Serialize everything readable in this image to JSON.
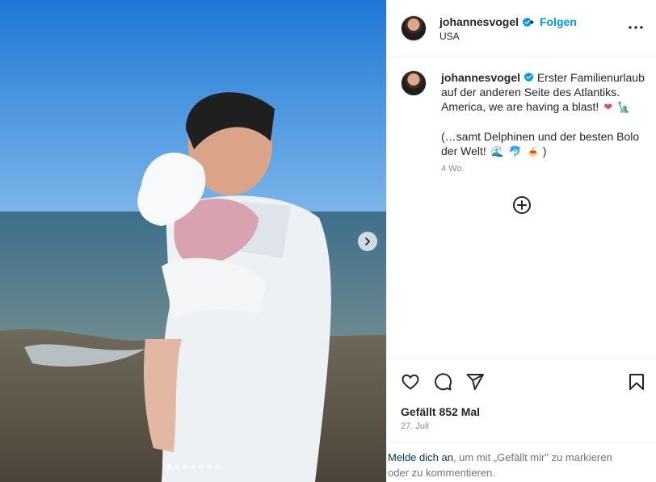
{
  "post": {
    "username": "johannesvogel",
    "follow_label": "Folgen",
    "separator": "•",
    "location": "USA",
    "caption_lines": [
      "Erster Familienurlaub",
      "auf der anderen Seite des Atlantiks.",
      "America, we are having a blast!",
      "(…samt Delphinen und der besten Bolo",
      "der Welt!"
    ],
    "caption_close": ")",
    "emojis": {
      "heart": "❤",
      "liberty": "🗽",
      "wave": "🌊",
      "dolphin": "🐬",
      "bolo": "🍝"
    },
    "time_ago": "4 Wo.",
    "likes": "Gefällt 852 Mal",
    "date": "27. Juli",
    "carousel": {
      "total": 7,
      "current": 1
    }
  },
  "login_prompt": {
    "link": "Melde dich an",
    "text_1": ", um mit „Gefällt mir\" zu markieren",
    "text_2": "oder zu kommentieren."
  },
  "colors": {
    "accent": "#0095f6",
    "verified": "#0095f6",
    "link": "#00376b",
    "sky": "#2f86d8",
    "sea": "#3c6d8c"
  },
  "icons": [
    "verified-badge-icon",
    "more-options-icon",
    "add-comment-icon",
    "heart-icon",
    "comment-icon",
    "share-icon",
    "bookmark-icon",
    "chevron-right-icon"
  ]
}
